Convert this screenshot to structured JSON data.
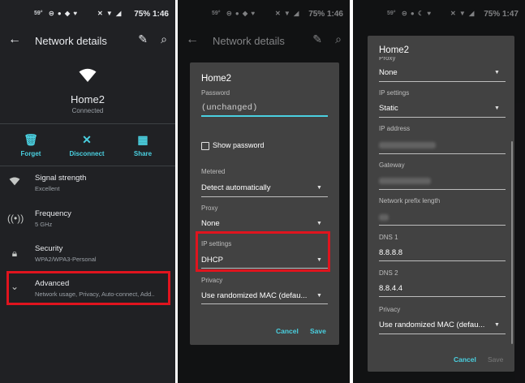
{
  "statusbar": {
    "p1": {
      "temp": "59°",
      "right": "75%  1:46"
    },
    "p2": {
      "temp": "59°",
      "right": "75%  1:46"
    },
    "p3": {
      "temp": "59°",
      "right": "75%  1:47"
    }
  },
  "details": {
    "title": "Network details",
    "network_name": "Home2",
    "status": "Connected",
    "actions": [
      {
        "label": "Forget",
        "icon": "trash-icon"
      },
      {
        "label": "Disconnect",
        "icon": "close-icon"
      },
      {
        "label": "Share",
        "icon": "qr-code-icon"
      }
    ],
    "rows": [
      {
        "title": "Signal strength",
        "subtitle": "Excellent",
        "icon": "wifi-icon"
      },
      {
        "title": "Frequency",
        "subtitle": "5 GHz",
        "icon": "radio-tower-icon"
      },
      {
        "title": "Security",
        "subtitle": "WPA2/WPA3-Personal",
        "icon": "lock-icon"
      },
      {
        "title": "Advanced",
        "subtitle": "Network usage, Privacy, Auto-connect, Add..",
        "icon": "chevron-down-icon"
      }
    ],
    "highlight_color": "#e0141e",
    "accent_color": "#4ad0e0"
  },
  "dialog_dhcp": {
    "title": "Home2",
    "password_label": "Password",
    "password_value": "(unchanged)",
    "show_password_label": "Show password",
    "metered_label": "Metered",
    "metered_value": "Detect automatically",
    "proxy_label": "Proxy",
    "proxy_value": "None",
    "ip_settings_label": "IP settings",
    "ip_settings_value": "DHCP",
    "privacy_label": "Privacy",
    "privacy_value": "Use randomized MAC (defau...",
    "cancel": "Cancel",
    "save": "Save"
  },
  "dialog_static": {
    "title": "Home2",
    "proxy_label": "Proxy",
    "proxy_value": "None",
    "ip_settings_label": "IP settings",
    "ip_settings_value": "Static",
    "ip_address_label": "IP address",
    "gateway_label": "Gateway",
    "prefix_label": "Network prefix length",
    "dns1_label": "DNS 1",
    "dns1_value": "8.8.8.8",
    "dns2_label": "DNS 2",
    "dns2_value": "8.8.4.4",
    "privacy_label": "Privacy",
    "privacy_value": "Use randomized MAC (defau...",
    "cancel": "Cancel",
    "save": "Save"
  }
}
